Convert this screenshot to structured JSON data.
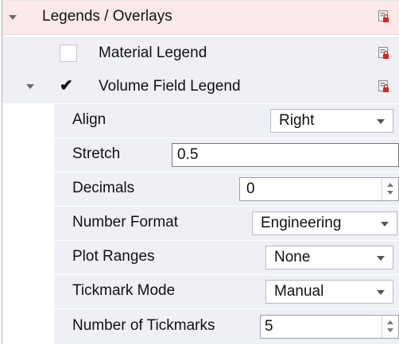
{
  "legends_header": {
    "label": "Legends / Overlays"
  },
  "material_legend": {
    "label": "Material Legend",
    "checked": false
  },
  "volume_field_legend": {
    "label": "Volume Field Legend",
    "checked": true,
    "check_glyph": "✔"
  },
  "properties": {
    "align": {
      "label": "Align",
      "value": "Right"
    },
    "stretch": {
      "label": "Stretch",
      "value": "0.5"
    },
    "decimals": {
      "label": "Decimals",
      "value": "0"
    },
    "number_format": {
      "label": "Number Format",
      "value": "Engineering"
    },
    "plot_ranges": {
      "label": "Plot Ranges",
      "value": "None"
    },
    "tickmark_mode": {
      "label": "Tickmark Mode",
      "value": "Manual"
    },
    "number_of_tickmarks": {
      "label": "Number of Tickmarks",
      "value": "5"
    }
  },
  "icons": {
    "lock": "lock-badge-icon",
    "expand": "triangle-expanded-icon"
  },
  "colors": {
    "header_bg": "#fbe9ea",
    "row_bg": "#eef0f6",
    "lock_red": "#d9241f"
  }
}
